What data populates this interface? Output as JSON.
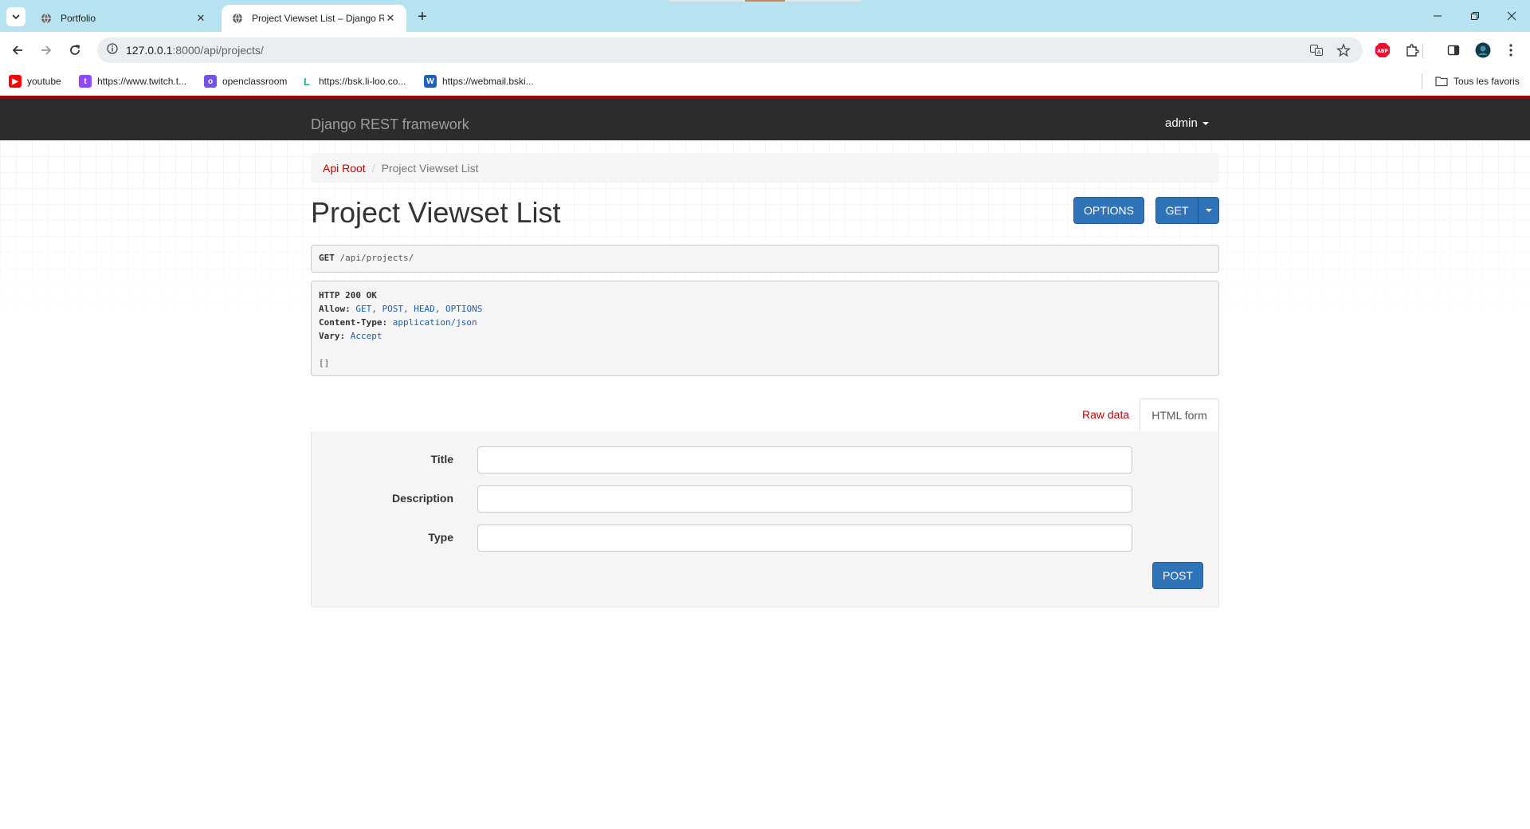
{
  "browser": {
    "tabs": [
      {
        "title": "Portfolio",
        "active": false
      },
      {
        "title": "Project Viewset List – Django RE",
        "active": true
      }
    ],
    "url_host": "127.0.0.1",
    "url_rest": ":8000/api/projects/",
    "bookmarks": [
      {
        "label": "youtube",
        "icon": "youtube-icon",
        "color": "#ff0000"
      },
      {
        "label": "https://www.twitch.t...",
        "icon": "twitch-icon",
        "color": "#9146ff"
      },
      {
        "label": "openclassroom",
        "icon": "openclassrooms-icon",
        "color": "#7451eb"
      },
      {
        "label": "https://bsk.li-loo.co...",
        "icon": "li-loo-icon",
        "color": "#22b573"
      },
      {
        "label": "https://webmail.bski...",
        "icon": "webmail-icon",
        "color": "#1e5fbf"
      }
    ],
    "all_bookmarks_label": "Tous les favoris"
  },
  "navbar": {
    "brand": "Django REST framework",
    "user": "admin"
  },
  "breadcrumb": {
    "root": "Api Root",
    "current": "Project Viewset List"
  },
  "page": {
    "title": "Project Viewset List",
    "options_label": "OPTIONS",
    "get_label": "GET"
  },
  "request": {
    "method": "GET",
    "path": "/api/projects/"
  },
  "response": {
    "status": "HTTP 200 OK",
    "headers": [
      {
        "key": "Allow:",
        "value": "GET, POST, HEAD, OPTIONS"
      },
      {
        "key": "Content-Type:",
        "value": "application/json"
      },
      {
        "key": "Vary:",
        "value": "Accept"
      }
    ],
    "body": "[]"
  },
  "form_tabs": {
    "raw": "Raw data",
    "html": "HTML form"
  },
  "form": {
    "fields": [
      {
        "label": "Title",
        "value": ""
      },
      {
        "label": "Description",
        "value": ""
      },
      {
        "label": "Type",
        "value": ""
      }
    ],
    "submit_label": "POST"
  },
  "colors": {
    "navbar": "#2c2c2c",
    "navbar_accent": "#a30000",
    "link": "#c20000",
    "primary_button": "#2f73b8",
    "tabstrip": "#b6e3ef"
  }
}
